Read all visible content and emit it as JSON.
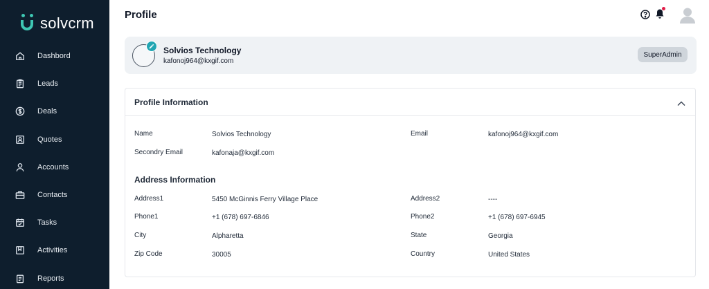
{
  "brand": {
    "name": "solvcrm",
    "accent": "#3ec7b3",
    "sidebar_bg": "#0e1e2d"
  },
  "sidebar": {
    "items": [
      {
        "label": "Dashbord",
        "icon": "home-icon"
      },
      {
        "label": "Leads",
        "icon": "clipboard-icon"
      },
      {
        "label": "Deals",
        "icon": "dollar-circle-icon"
      },
      {
        "label": "Quotes",
        "icon": "quote-card-icon"
      },
      {
        "label": "Accounts",
        "icon": "user-icon"
      },
      {
        "label": "Contacts",
        "icon": "briefcase-icon"
      },
      {
        "label": "Tasks",
        "icon": "calendar-icon"
      },
      {
        "label": "Activities",
        "icon": "bookmark-icon"
      },
      {
        "label": "Reports",
        "icon": "report-icon"
      }
    ]
  },
  "header": {
    "title": "Profile",
    "icons": [
      "help-circle-icon",
      "bell-icon",
      "avatar-icon"
    ]
  },
  "profile_card": {
    "name": "Solvios Technology",
    "email": "kafonoj964@kxgif.com",
    "role": "SuperAdmin",
    "icons": [
      "avatar-ring-icon",
      "pencil-icon"
    ]
  },
  "profile_info": {
    "title": "Profile Information",
    "fields": {
      "name_label": "Name",
      "name_value": "Solvios Technology",
      "email_label": "Email",
      "email_value": "kafonoj964@kxgif.com",
      "secondary_email_label": "Secondry Email",
      "secondary_email_value": "kafonaja@kxgif.com"
    },
    "collapse_icon": "chevron-up-icon"
  },
  "address_info": {
    "title": "Address Information",
    "address1_label": "Address1",
    "address1_value": "5450 McGinnis Ferry Village Place",
    "address2_label": "Address2",
    "address2_value": "----",
    "phone1_label": "Phone1",
    "phone1_value": "+1 (678) 697-6846",
    "phone2_label": "Phone2",
    "phone2_value": "+1 (678) 697-6945",
    "city_label": "City",
    "city_value": "Alpharetta",
    "state_label": "State",
    "state_value": "Georgia",
    "zip_label": "Zip Code",
    "zip_value": "30005",
    "country_label": "Country",
    "country_value": "United States"
  }
}
